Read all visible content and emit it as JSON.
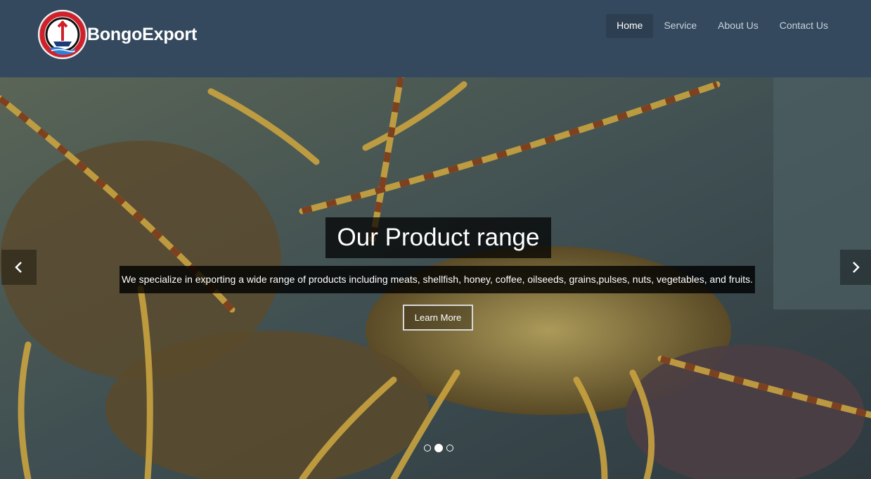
{
  "brand": {
    "name": "BongoExport",
    "logo_icon": "ship-logo-icon"
  },
  "nav": {
    "items": [
      {
        "label": "Home",
        "active": true
      },
      {
        "label": "Service",
        "active": false
      },
      {
        "label": "About Us",
        "active": false
      },
      {
        "label": "Contact Us",
        "active": false
      }
    ]
  },
  "hero": {
    "title": "Our Product range",
    "description": "We specialize in exporting a wide range of products including meats, shellfish, honey, coffee, oilseeds, grains,pulses, nuts, vegetables, and fruits.",
    "button_label": "Learn More",
    "prev_icon": "chevron-left-icon",
    "next_icon": "chevron-right-icon",
    "slides": 3,
    "active_slide": 2
  },
  "colors": {
    "navbar": "#34495e",
    "nav_active": "#2c3e50",
    "caption_bg": "#000000"
  }
}
